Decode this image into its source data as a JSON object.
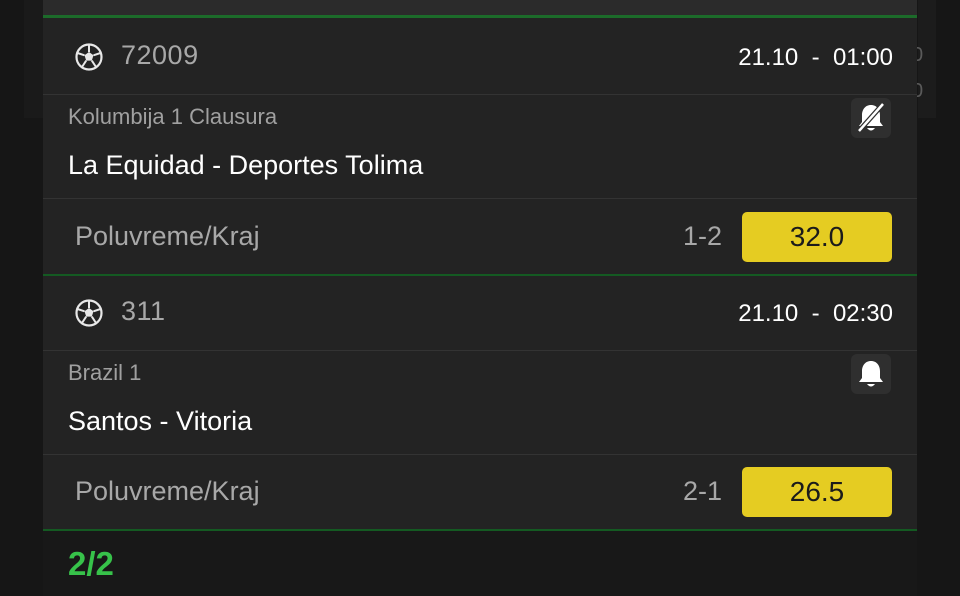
{
  "colors": {
    "background": "#161616",
    "card": "#232323",
    "accent_green": "#37c24a",
    "divider_green": "#1c6b2a",
    "odds_yellow": "#e5cc22"
  },
  "background_edge": [
    "0",
    "0"
  ],
  "matches": [
    {
      "id": "72009",
      "date": "21.10  -  01:00",
      "league": "Kolumbija 1 Clausura",
      "teams": "La Equidad - Deportes Tolima",
      "notification": "muted",
      "notification_icon": "bell-slash-icon",
      "bet_type": "Poluvreme/Kraj",
      "pick": "1-2",
      "odds": "32.0"
    },
    {
      "id": "311",
      "date": "21.10  -  02:30",
      "league": "Brazil 1",
      "teams": "Santos - Vitoria",
      "notification": "active",
      "notification_icon": "bell-icon",
      "bet_type": "Poluvreme/Kraj",
      "pick": "2-1",
      "odds": "26.5"
    }
  ],
  "footer": {
    "count": "2/2"
  }
}
